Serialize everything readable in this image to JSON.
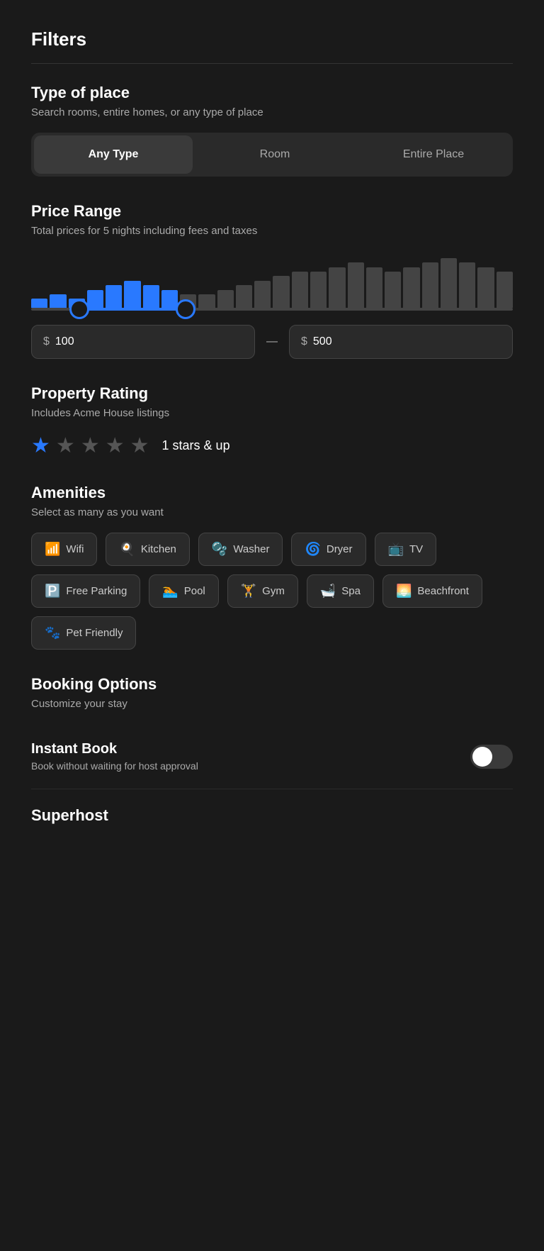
{
  "page": {
    "title": "Filters"
  },
  "type_of_place": {
    "section_title": "Type of place",
    "section_subtitle": "Search rooms, entire homes, or any type of place",
    "options": [
      {
        "id": "any",
        "label": "Any Type",
        "active": true
      },
      {
        "id": "room",
        "label": "Room",
        "active": false
      },
      {
        "id": "entire",
        "label": "Entire Place",
        "active": false
      }
    ]
  },
  "price_range": {
    "section_title": "Price Range",
    "section_subtitle": "Total prices for 5 nights including fees and taxes",
    "min_value": "100",
    "max_value": "500",
    "currency_symbol": "$",
    "dash": "—"
  },
  "property_rating": {
    "section_title": "Property Rating",
    "section_subtitle": "Includes Acme House listings",
    "selected_stars": 1,
    "total_stars": 5,
    "label": "1 stars & up"
  },
  "amenities": {
    "section_title": "Amenities",
    "section_subtitle": "Select as many as you want",
    "items": [
      {
        "id": "wifi",
        "label": "Wifi",
        "icon": "📶"
      },
      {
        "id": "kitchen",
        "label": "Kitchen",
        "icon": "🍳"
      },
      {
        "id": "washer",
        "label": "Washer",
        "icon": "🫧"
      },
      {
        "id": "dryer",
        "label": "Dryer",
        "icon": "🌀"
      },
      {
        "id": "tv",
        "label": "TV",
        "icon": "📺"
      },
      {
        "id": "parking",
        "label": "Free Parking",
        "icon": "🅿️"
      },
      {
        "id": "pool",
        "label": "Pool",
        "icon": "🏊"
      },
      {
        "id": "gym",
        "label": "Gym",
        "icon": "🏋️"
      },
      {
        "id": "spa",
        "label": "Spa",
        "icon": "🛁"
      },
      {
        "id": "beachfront",
        "label": "Beachfront",
        "icon": "🌅"
      },
      {
        "id": "pet_friendly",
        "label": "Pet Friendly",
        "icon": "🐾"
      }
    ]
  },
  "booking_options": {
    "section_title": "Booking Options",
    "section_subtitle": "Customize your stay",
    "instant_book": {
      "title": "Instant Book",
      "subtitle": "Book without waiting for host approval",
      "enabled": false
    },
    "superhost": {
      "title": "Superhost"
    }
  },
  "bars": {
    "active_count": 8,
    "total_count": 26,
    "data": [
      2,
      3,
      2,
      4,
      5,
      6,
      5,
      4,
      3,
      3,
      4,
      5,
      6,
      7,
      8,
      8,
      9,
      10,
      9,
      8,
      9,
      10,
      11,
      10,
      9,
      8
    ]
  }
}
